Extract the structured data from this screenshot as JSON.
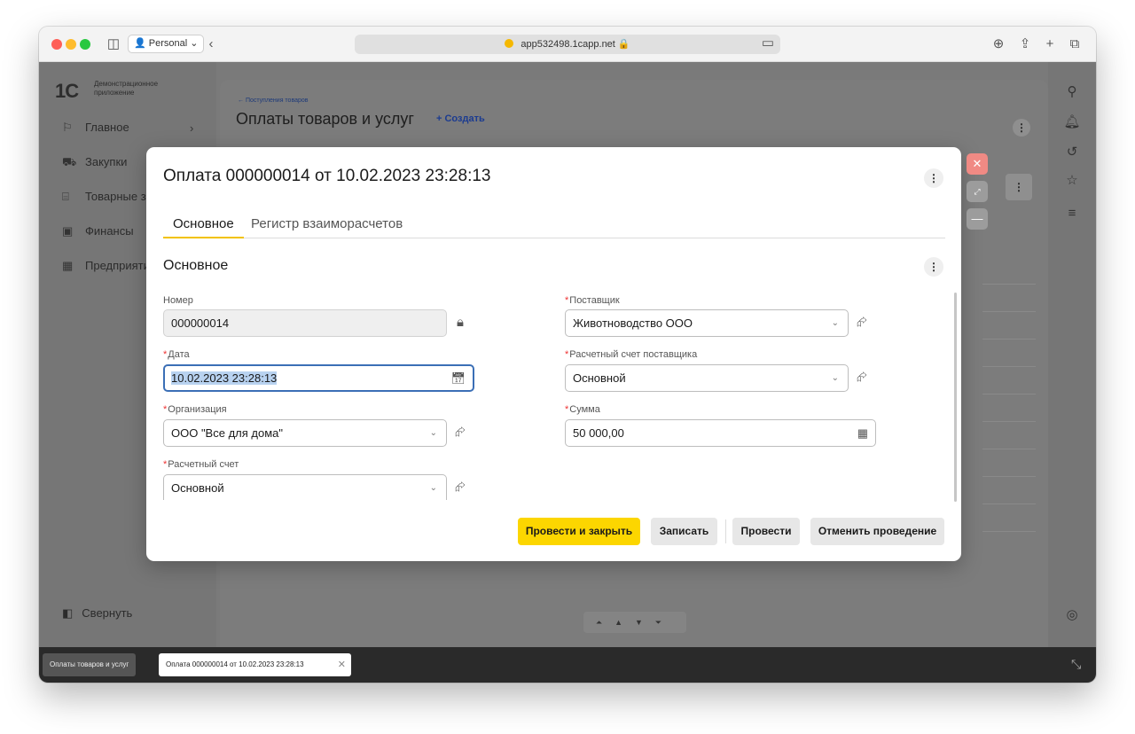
{
  "browser": {
    "profile": "Personal",
    "url": "app532498.1capp.net"
  },
  "sidebar": {
    "logo_mark": "1С",
    "logo_text": "Демонстрационное приложение",
    "items": [
      {
        "label": "Главное"
      },
      {
        "label": "Закупки"
      },
      {
        "label": "Товарные з"
      },
      {
        "label": "Финансы"
      },
      {
        "label": "Предприяти"
      }
    ],
    "collapse_label": "Свернуть"
  },
  "list": {
    "back_link": "← Поступления товаров",
    "title": "Оплаты товаров и услуг",
    "create_label": "+ Создать"
  },
  "dialog": {
    "title": "Оплата 000000014 от 10.02.2023 23:28:13",
    "tabs": [
      {
        "label": "Основное",
        "active": true
      },
      {
        "label": "Регистр взаиморасчетов",
        "active": false
      }
    ],
    "section_title": "Основное",
    "fields": {
      "number": {
        "label": "Номер",
        "value": "000000014",
        "required": false
      },
      "date": {
        "label": "Дата",
        "value": "10.02.2023 23:28:13",
        "required": true
      },
      "organization": {
        "label": "Организация",
        "value": "ООО \"Все для дома\"",
        "required": true
      },
      "account": {
        "label": "Расчетный счет",
        "value": "Основной",
        "required": true
      },
      "supplier": {
        "label": "Поставщик",
        "value": "Животноводство ООО",
        "required": true
      },
      "supplier_account": {
        "label": "Расчетный счет поставщика",
        "value": "Основной",
        "required": true
      },
      "amount": {
        "label": "Сумма",
        "value": "50 000,00",
        "required": true
      }
    },
    "buttons": {
      "post_close": "Провести и закрыть",
      "save": "Записать",
      "post": "Провести",
      "cancel_post": "Отменить проведение"
    }
  },
  "bottom_tabs": [
    {
      "label": "Оплаты товаров и услуг"
    },
    {
      "label": "Оплата 000000014 от 10.02.2023 23:28:13"
    }
  ],
  "colors": {
    "accent_yellow": "#fcd600",
    "focus_blue": "#3b6fb6",
    "required_red": "#e33333"
  }
}
